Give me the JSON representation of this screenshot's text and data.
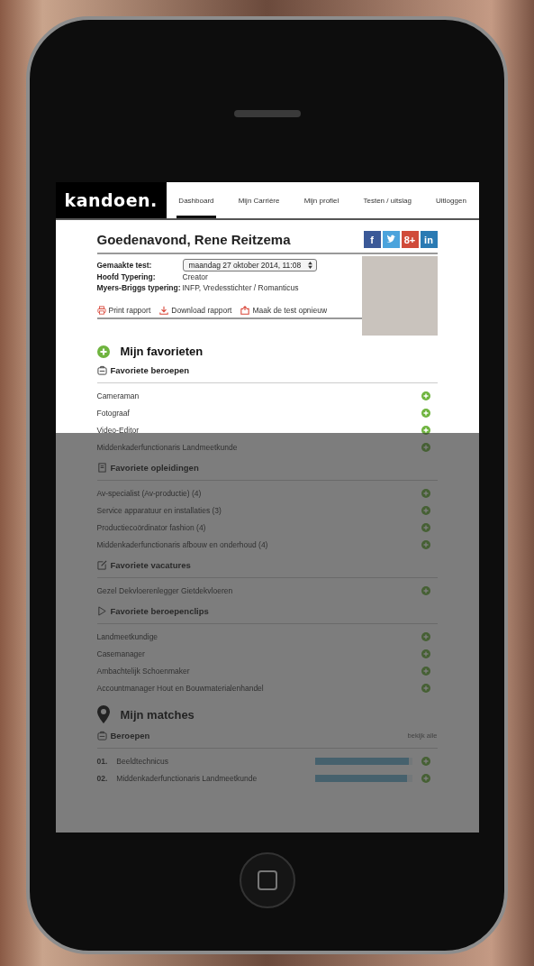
{
  "logo": "kandoen.",
  "nav": [
    {
      "label": "Dashboard",
      "selected": true
    },
    {
      "label": "Mijn Carrière",
      "selected": false
    },
    {
      "label": "Mijn profiel",
      "selected": false
    },
    {
      "label": "Testen / uitslag",
      "selected": false
    },
    {
      "label": "Uitloggen",
      "selected": false
    }
  ],
  "greeting": "Goedenavond, Rene Reitzema",
  "social": [
    {
      "kind": "facebook",
      "glyph": "f"
    },
    {
      "kind": "twitter"
    },
    {
      "kind": "googleplus",
      "glyph": "8+"
    },
    {
      "kind": "linkedin",
      "glyph": "in"
    }
  ],
  "profile": {
    "test_label": "Gemaakte test:",
    "test_value": "maandag 27 oktober 2014, 11:08",
    "rows": [
      {
        "label": "Hoofd Typering:",
        "value": "Creator"
      },
      {
        "label": "Myers-Briggs typering:",
        "value": "INFP, Vredesstichter / Romanticus"
      }
    ]
  },
  "actions": [
    {
      "kind": "print",
      "label": "Print rapport"
    },
    {
      "kind": "download",
      "label": "Download rapport"
    },
    {
      "kind": "restart",
      "label": "Maak de test opnieuw"
    }
  ],
  "favorites": {
    "title": "Mijn favorieten",
    "sections": [
      {
        "kind": "briefcase",
        "title": "Favoriete beroepen",
        "items": [
          "Cameraman",
          "Fotograaf",
          "Video-Editor",
          "Middenkaderfunctionaris Landmeetkunde"
        ]
      },
      {
        "kind": "book",
        "title": "Favoriete opleidingen",
        "items": [
          "Av-specialist (Av-productie) (4)",
          "Service apparatuur en installaties (3)",
          "Productiecoördinator fashion (4)",
          "Middenkaderfunctionaris afbouw en onderhoud (4)"
        ]
      },
      {
        "kind": "edit",
        "title": "Favoriete vacatures",
        "items": [
          "Gezel Dekvloerenlegger Gietdekvloeren"
        ]
      },
      {
        "kind": "play",
        "title": "Favoriete beroepenclips",
        "items": [
          "Landmeetkundige",
          "Casemanager",
          "Ambachtelijk Schoenmaker",
          "Accountmanager Hout en Bouwmaterialenhandel"
        ]
      }
    ]
  },
  "matches": {
    "title": "Mijn matches",
    "section": "Beroepen",
    "link": "bekijk alle",
    "rows": [
      {
        "rank": "01.",
        "name": "Beeldtechnicus",
        "level": 0.97
      },
      {
        "rank": "02.",
        "name": "Middenkaderfunctionaris Landmeetkunde",
        "level": 0.95
      }
    ]
  }
}
